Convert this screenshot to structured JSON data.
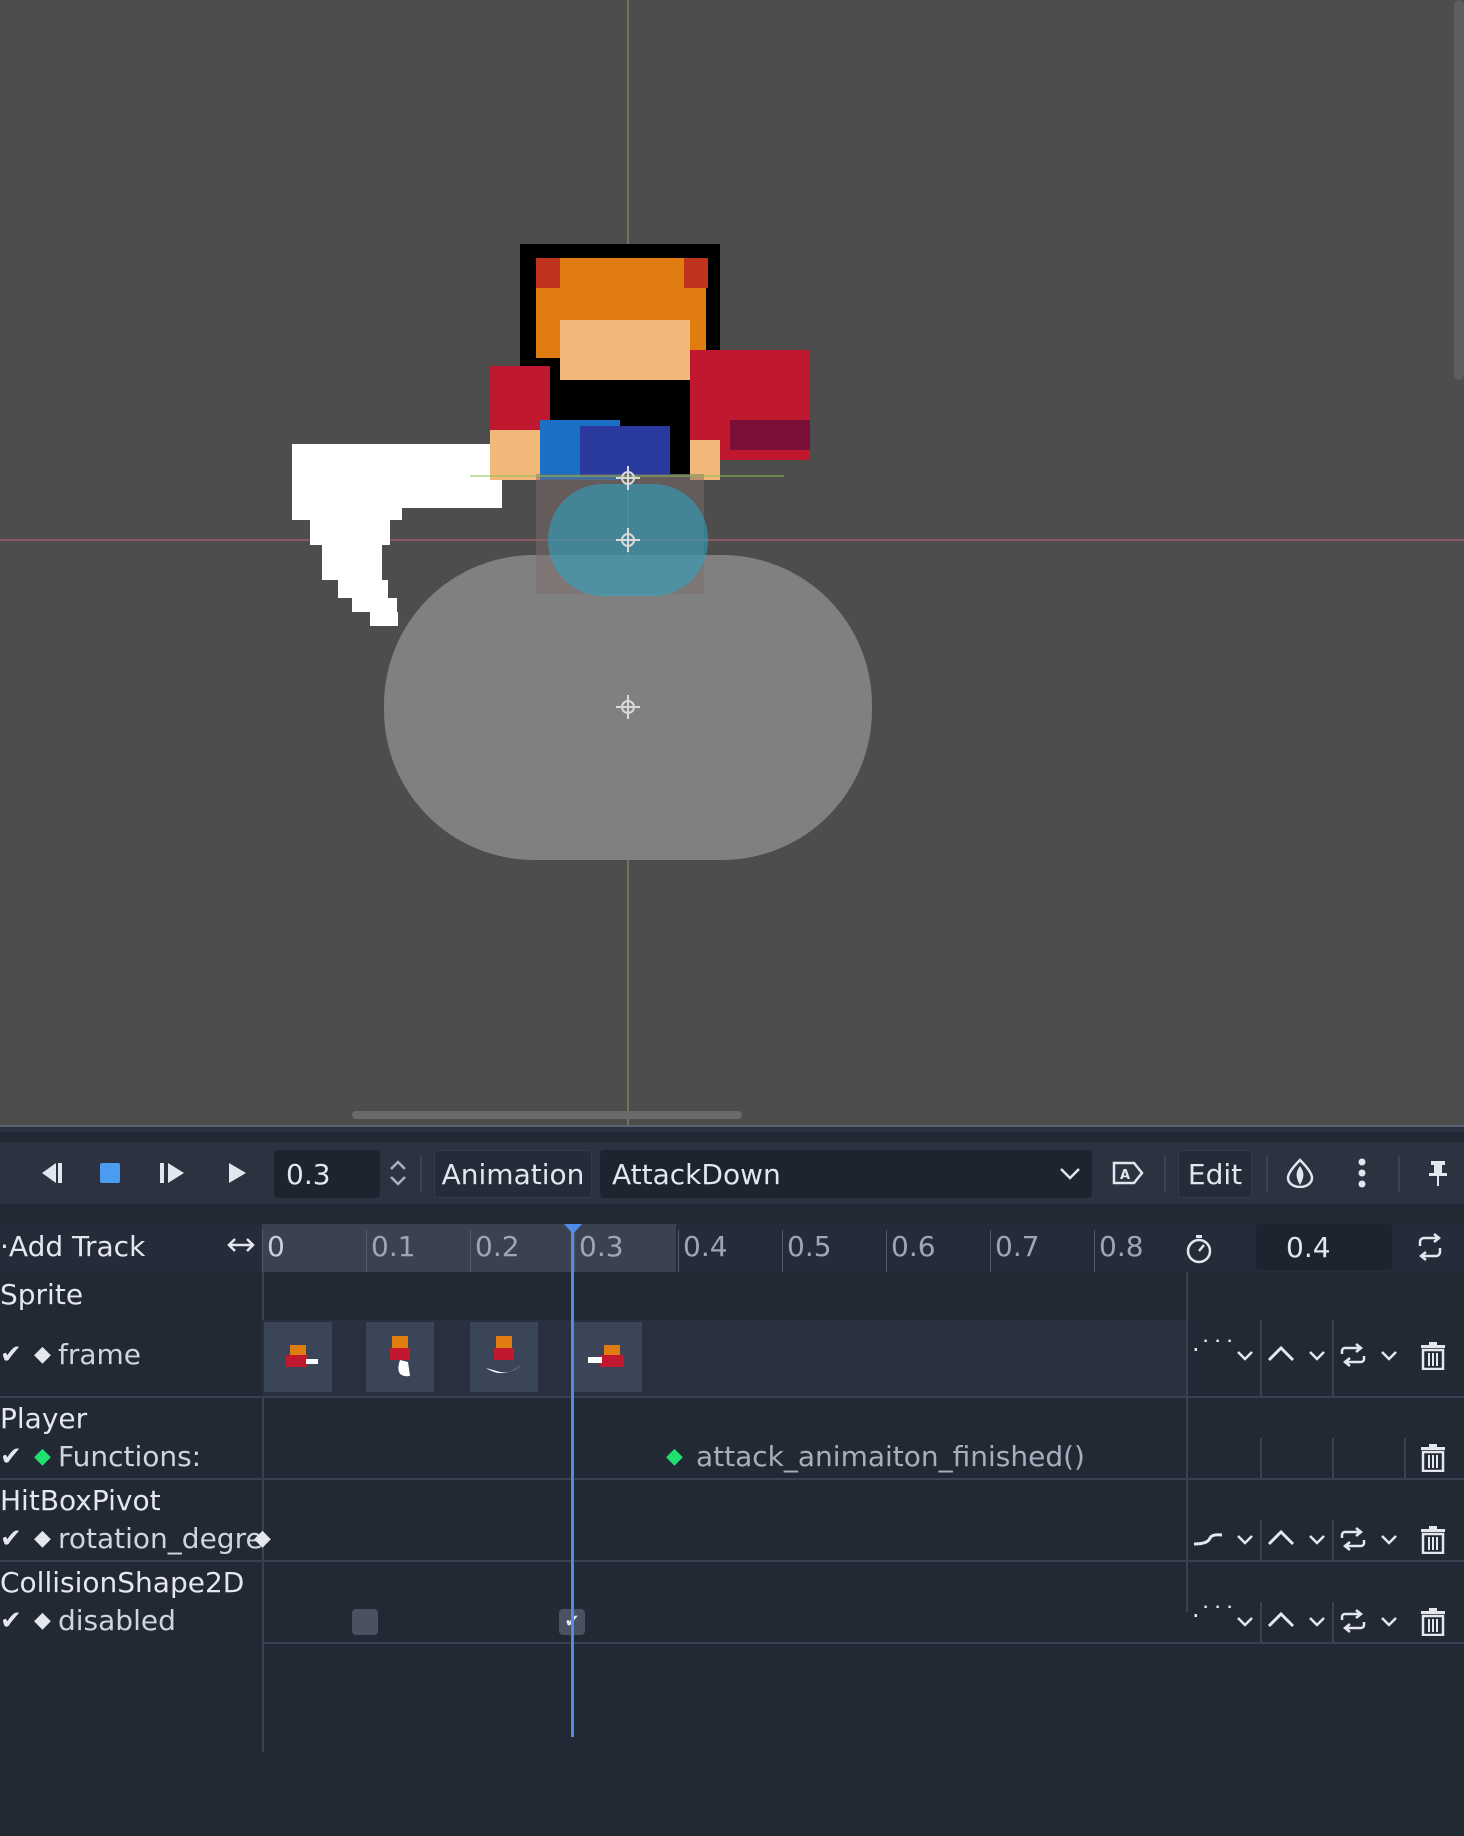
{
  "toolbar": {
    "time_value": "0.3",
    "animation_label": "Animation",
    "animation_name": "AttackDown",
    "edit_label": "Edit"
  },
  "timeline": {
    "add_track_label": "Add Track",
    "ticks": [
      "0",
      "0.1",
      "0.2",
      "0.3",
      "0.4",
      "0.5",
      "0.6",
      "0.7",
      "0.8"
    ],
    "length_value": "0.4",
    "playhead_time": 0.3
  },
  "tracks": {
    "sprite_group": "Sprite",
    "sprite_track": "frame",
    "player_group": "Player",
    "player_track": "Functions:",
    "player_method_key": "attack_animaiton_finished()",
    "hitbox_group": "HitBoxPivot",
    "hitbox_track": "rotation_degre",
    "collision_group": "CollisionShape2D",
    "collision_track": "disabled"
  },
  "colors": {
    "panel_bg": "#222834",
    "viewport_bg": "#4d4d4d",
    "accent": "#4f8ce8",
    "method_key": "#20e070"
  }
}
